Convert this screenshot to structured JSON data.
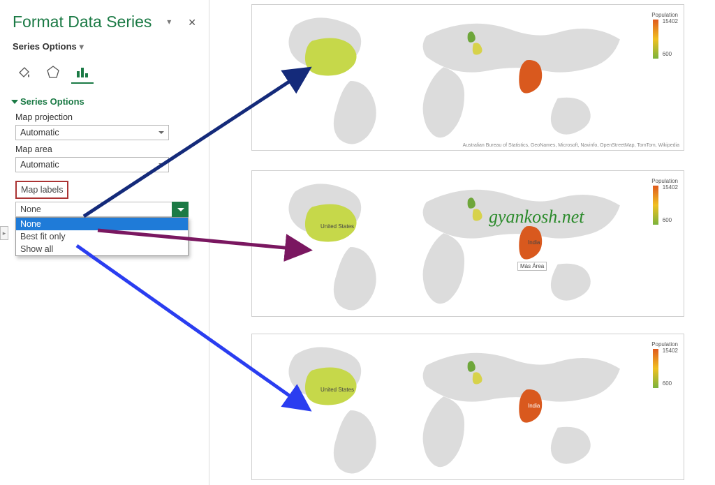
{
  "panel": {
    "title": "Format Data Series",
    "options_button": "Series Options",
    "section_header": "Series Options",
    "fields": {
      "projection_label": "Map projection",
      "projection_value": "Automatic",
      "area_label": "Map area",
      "area_value": "Automatic",
      "labels_label": "Map labels",
      "labels_value": "None",
      "labels_options": [
        "None",
        "Best fit only",
        "Show all"
      ]
    },
    "icons": {
      "fill": "paint-bucket-icon",
      "effects": "pentagon-icon",
      "chart": "bar-chart-icon",
      "expand": "chevron-down-icon",
      "close": "close-icon",
      "collapse": "arrow-right-icon"
    }
  },
  "maps": {
    "legend_title": "Population",
    "legend_high": "15402",
    "legend_low": "600",
    "labels": {
      "us": "United States",
      "in": "India",
      "pt": "Más Área"
    },
    "attribution": "Australian Bureau of Statistics, GeoNames, Microsoft, Navinfo, OpenStreetMap, TomTom, Wikipedia"
  },
  "watermark": "gyankosh.net",
  "colors": {
    "accent": "#1b7a45",
    "arrow_none": "#142a7a",
    "arrow_best": "#7a1760",
    "arrow_all": "#2a3df0",
    "land": "#dcdcdc",
    "us": "#c6d84a",
    "in": "#d9591e",
    "uk": "#6ea63a",
    "fr": "#d7d24a"
  }
}
